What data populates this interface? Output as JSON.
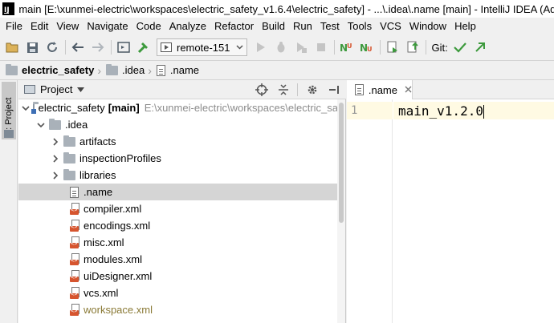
{
  "window": {
    "title": "main [E:\\xunmei-electric\\workspaces\\electric_safety_v1.6.4\\electric_safety] - ...\\.idea\\.name [main] - IntelliJ IDEA (Adminis",
    "app_icon_text": "IJ"
  },
  "menu": [
    "File",
    "Edit",
    "View",
    "Navigate",
    "Code",
    "Analyze",
    "Refactor",
    "Build",
    "Run",
    "Test",
    "Tools",
    "VCS",
    "Window",
    "Help"
  ],
  "toolbar": {
    "run_config": "remote-151",
    "git_label": "Git:"
  },
  "breadcrumb": {
    "project": "electric_safety",
    "folder": ".idea",
    "file": ".name"
  },
  "toolstrip": {
    "tab_label": "1: Project"
  },
  "project_panel": {
    "title": "Project",
    "tree": [
      {
        "label": "electric_safety",
        "suffix": "[main]",
        "path": "E:\\xunmei-electric\\workspaces\\electric_sa"
      },
      {
        "label": ".idea"
      },
      {
        "label": "artifacts"
      },
      {
        "label": "inspectionProfiles"
      },
      {
        "label": "libraries"
      },
      {
        "label": ".name"
      },
      {
        "label": "compiler.xml"
      },
      {
        "label": "encodings.xml"
      },
      {
        "label": "misc.xml"
      },
      {
        "label": "modules.xml"
      },
      {
        "label": "uiDesigner.xml"
      },
      {
        "label": "vcs.xml"
      },
      {
        "label": "workspace.xml"
      }
    ]
  },
  "editor": {
    "tab_label": ".name",
    "line_number": "1",
    "content": "main_v1.2.0"
  },
  "colors": {
    "accent_green": "#3d9a3d",
    "selection_gray": "#d5d5d5",
    "modified_file": "#8a7a36",
    "current_line": "#fffae3",
    "xml_icon": "#d6552f"
  }
}
